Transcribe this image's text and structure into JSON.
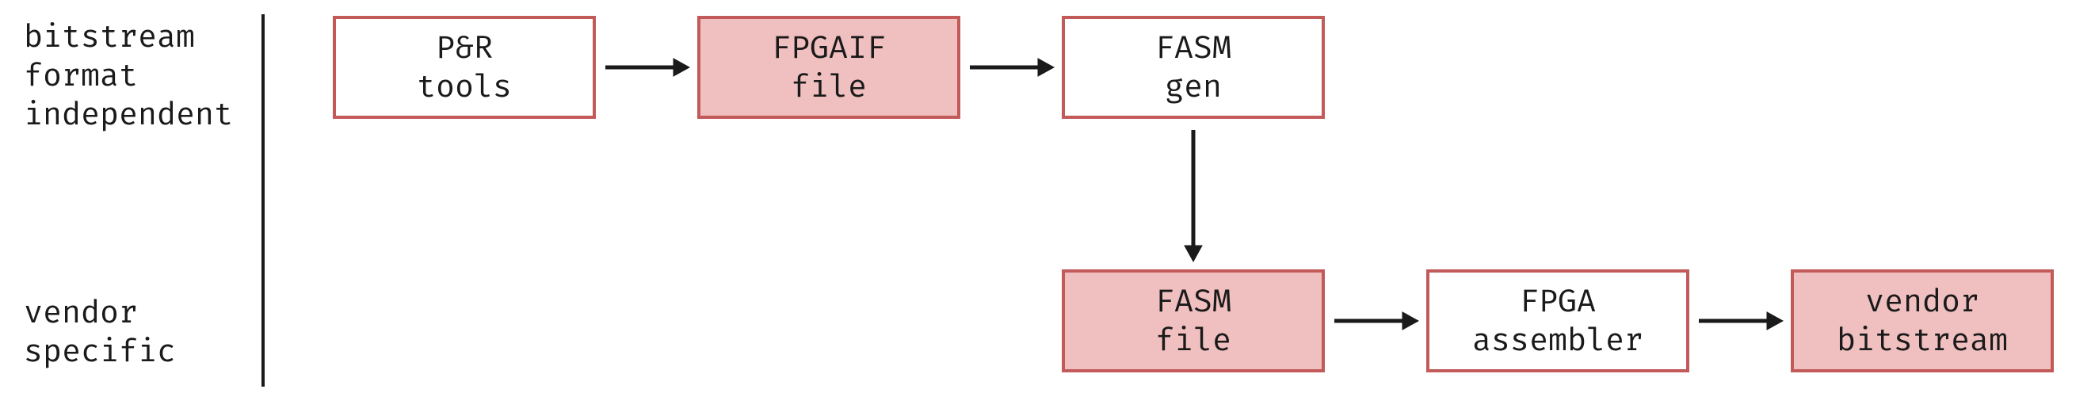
{
  "row_labels": {
    "top": "bitstream\nformat\nindependent",
    "bottom": "vendor\nspecific"
  },
  "nodes": {
    "pr_tools": {
      "label": "P&R\ntools",
      "filled": false,
      "row": "top"
    },
    "fpgaif_file": {
      "label": "FPGAIF\nfile",
      "filled": true,
      "row": "top"
    },
    "fasm_gen": {
      "label": "FASM\ngen",
      "filled": false,
      "row": "top"
    },
    "fasm_file": {
      "label": "FASM\nfile",
      "filled": true,
      "row": "bottom"
    },
    "fpga_assembler": {
      "label": "FPGA\nassembler",
      "filled": false,
      "row": "bottom"
    },
    "vendor_bitstream": {
      "label": "vendor\nbitstream",
      "filled": true,
      "row": "bottom"
    }
  },
  "edges": [
    {
      "from": "pr_tools",
      "to": "fpgaif_file",
      "dir": "right"
    },
    {
      "from": "fpgaif_file",
      "to": "fasm_gen",
      "dir": "right"
    },
    {
      "from": "fasm_gen",
      "to": "fasm_file",
      "dir": "down"
    },
    {
      "from": "fasm_file",
      "to": "fpga_assembler",
      "dir": "right"
    },
    {
      "from": "fpga_assembler",
      "to": "vendor_bitstream",
      "dir": "right"
    }
  ],
  "colors": {
    "border": "#c25a5a",
    "fill": "#f0bfbf",
    "ink": "#1a1a1a"
  }
}
